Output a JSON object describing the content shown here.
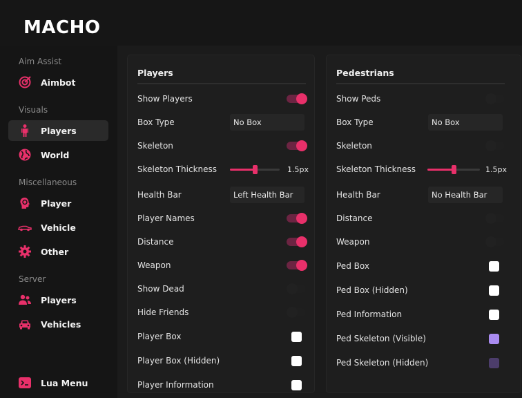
{
  "app": {
    "logo": "MACHO"
  },
  "sidebar": {
    "sections": [
      {
        "label": "Aim Assist",
        "items": [
          {
            "label": "Aimbot",
            "icon": "crosshair-target-icon"
          }
        ]
      },
      {
        "label": "Visuals",
        "items": [
          {
            "label": "Players",
            "icon": "person-icon",
            "active": true
          },
          {
            "label": "World",
            "icon": "globe-icon"
          }
        ]
      },
      {
        "label": "Miscellaneous",
        "items": [
          {
            "label": "Player",
            "icon": "head-profile-icon"
          },
          {
            "label": "Vehicle",
            "icon": "car-side-icon"
          },
          {
            "label": "Other",
            "icon": "gear-icon"
          }
        ]
      },
      {
        "label": "Server",
        "items": [
          {
            "label": "Players",
            "icon": "users-icon"
          },
          {
            "label": "Vehicles",
            "icon": "car-front-icon"
          }
        ]
      }
    ],
    "footer": {
      "label": "Lua Menu",
      "icon": "terminal-icon"
    }
  },
  "colors": {
    "accent": "#e8306a",
    "accent_dark": "#6c2442",
    "purple": "#a98bf0",
    "purple_dark": "#4c3d6b"
  },
  "players_panel": {
    "title": "Players",
    "rows": {
      "show_players": {
        "label": "Show Players",
        "on": true
      },
      "box_type": {
        "label": "Box Type",
        "value": "No Box"
      },
      "skeleton": {
        "label": "Skeleton",
        "on": true
      },
      "skeleton_thickness": {
        "label": "Skeleton Thickness",
        "value": "1.5px",
        "fraction": 0.5
      },
      "health_bar": {
        "label": "Health Bar",
        "value": "Left Health Bar"
      },
      "player_names": {
        "label": "Player Names",
        "on": true
      },
      "distance": {
        "label": "Distance",
        "on": true
      },
      "weapon": {
        "label": "Weapon",
        "on": true
      },
      "show_dead": {
        "label": "Show Dead",
        "on": false
      },
      "hide_friends": {
        "label": "Hide Friends",
        "on": false
      },
      "player_box": {
        "label": "Player Box",
        "color": "#ffffff"
      },
      "player_box_hidden": {
        "label": "Player Box (Hidden)",
        "color": "#ffffff"
      },
      "player_information": {
        "label": "Player Information",
        "color": "#ffffff"
      }
    }
  },
  "peds_panel": {
    "title": "Pedestrians",
    "rows": {
      "show_peds": {
        "label": "Show Peds",
        "on": false
      },
      "box_type": {
        "label": "Box Type",
        "value": "No Box"
      },
      "skeleton": {
        "label": "Skeleton",
        "on": false
      },
      "skeleton_thickness": {
        "label": "Skeleton Thickness",
        "value": "1.5px",
        "fraction": 0.5
      },
      "health_bar": {
        "label": "Health Bar",
        "value": "No Health Bar"
      },
      "distance": {
        "label": "Distance",
        "on": false
      },
      "weapon": {
        "label": "Weapon",
        "on": false
      },
      "ped_box": {
        "label": "Ped Box",
        "color": "#ffffff"
      },
      "ped_box_hidden": {
        "label": "Ped Box (Hidden)",
        "color": "#ffffff"
      },
      "ped_information": {
        "label": "Ped Information",
        "color": "#ffffff"
      },
      "ped_skeleton_visible": {
        "label": "Ped Skeleton (Visible)",
        "color": "#a98bf0"
      },
      "ped_skeleton_hidden": {
        "label": "Ped Skeleton (Hidden)",
        "color": "#4c3d6b"
      }
    }
  }
}
